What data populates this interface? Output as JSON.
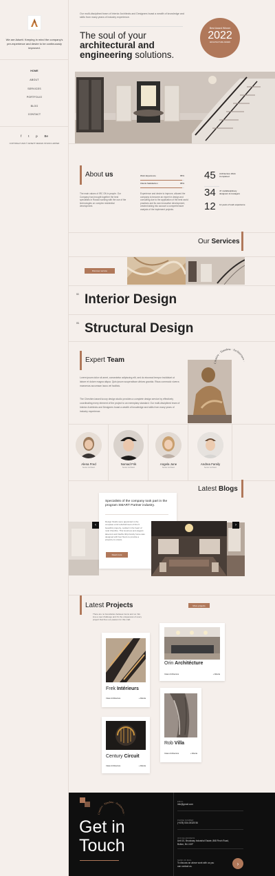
{
  "sidebar": {
    "intro": "We are Adsett. Keeping in mind the company's pre-experience and desire to be continuously improved.",
    "nav": [
      "HOME",
      "ABOUT",
      "SERVICES",
      "PORTFOLIO",
      "BLOG",
      "CONTACT"
    ],
    "social": [
      "f",
      "t",
      "p",
      "Be"
    ],
    "copyright": "COPYRIGHT 2023 © ADSETT DESIGN STUDIO LIMITED"
  },
  "hero": {
    "tagline": "Our multi-disciplined team of Interior Architects and Designers boast a wealth of knowledge and skills from many years of industry experience.",
    "title_l1": "The soul of your",
    "title_l2a": "architectural and",
    "title_l3a": "engineering",
    "title_l3b": " solutions.",
    "award_top": "Best Award Winner",
    "award_year": "2022",
    "award_bottom": "ARCHITECTURE AWARD"
  },
  "about": {
    "title_a": "About ",
    "title_b": "us",
    "bars": [
      {
        "label": "Work Experience",
        "value": "95%",
        "pct": 95
      },
      {
        "label": "Clients Satisfaction",
        "value": "95%",
        "pct": 95
      }
    ],
    "col1": "The main values of IRC ON in people. Our Company has brought together the best specialists in Russia working with the use of the technologies on complex residential development.",
    "col2": "Experience and desire to improve, allowed the company to become an expert in design and consulting due to the application of the best world practices and its own innovative development, created taking into account a comprehensive analysis of the implement projects.",
    "stats": [
      {
        "num": "45",
        "label": "Architecture Work Completed"
      },
      {
        "num": "34",
        "label": "47 multidisciplinary designers & managers"
      },
      {
        "num": "12",
        "label": "12 years of work experience"
      }
    ]
  },
  "services": {
    "title_a": "Our ",
    "title_b": "Services",
    "button": "Discover service",
    "items": [
      {
        "num": "02.",
        "name": "Interior Design"
      },
      {
        "num": "03.",
        "name": "Structural Design"
      }
    ]
  },
  "expert": {
    "title_a": "Expert ",
    "title_b": "Team",
    "p1": "Lorem ipsum dolor sit amet, consectetur adipiscing elit, sed do eiusmod tempor incididunt ut labore et dolore magna aliqua. Quis ipsum suspendisse ultrices gravida. Risus commodo viverra maecenas accumsan lacus vel facilisis.",
    "p2": "The Cheshire-based luxury design studio provides a complete design service by effectively coordinating every element of the project to an exemplary standard. Our multi-disciplined team of Interior Architects and Designers boast a wealth of knowledge and skills from many years of industry experience.",
    "ring": "Creative · Timeless · Architecture ·"
  },
  "team": [
    {
      "name": "Alena Fred",
      "role": "Senior Architect"
    },
    {
      "name": "Nomad Frik",
      "role": "Senior Architect"
    },
    {
      "name": "Angela June",
      "role": "Senior Architect"
    },
    {
      "name": "Andrea Family",
      "role": "Senior Architect"
    }
  ],
  "blogs": {
    "title_a": "Latest ",
    "title_b": "Blogs",
    "card_title": "Specialists of the company took part in the program SMART Partner industry.",
    "card_text": "Design Studio were appointed to the complete a full refurbishment of this 6 beautiful property, nestled in the heart of rural Cheshire. This luxurious and elegant lake-fent and Oadhs 4thpt family home was designed with four floors to provide a property to ensure.",
    "button": "Read more"
  },
  "projects": {
    "title_a": "Latest ",
    "title_b": "Projects",
    "button": "More projects",
    "intro": "There are no boundaries between items and us. We love a new challenge and it's the uniqueness of every project that fires our passion for this craft.",
    "items": [
      {
        "name_a": "Frek ",
        "name_b": "Intérieurs",
        "category": "Clean Architecture",
        "location": "Alberta"
      },
      {
        "name_a": "Orin ",
        "name_b": "Architécture",
        "category": "Clean Architecture",
        "location": "Alberta"
      },
      {
        "name_a": "Century ",
        "name_b": "Circuit",
        "category": "Clean Architecture",
        "location": "Alberta"
      },
      {
        "name_a": "Rob ",
        "name_b": "Villa",
        "category": "Clean Architecture",
        "location": "Alberta"
      }
    ]
  },
  "footer": {
    "title_l1": "Get in",
    "title_l2": "Touch",
    "ring": "Creative · Timeless · Architecture ·",
    "blocks": [
      {
        "label": "EMAIL",
        "value": "info@gmail.com"
      },
      {
        "label": "PHONE NUMBER",
        "value": "(+678) 534-00325 56"
      },
      {
        "label": "OFFICE ADDRESS",
        "value": "Unit 10, Brookway Industrial Estate, 868 Finch Road, Bolton, BL1 6XF"
      },
      {
        "label": "SEND US MAIL",
        "value": "To discuss an above work with us you can contact us."
      }
    ]
  },
  "colors": {
    "accent": "#b0785a",
    "bg": "#f5efeb",
    "footer": "#0f0f0f"
  }
}
